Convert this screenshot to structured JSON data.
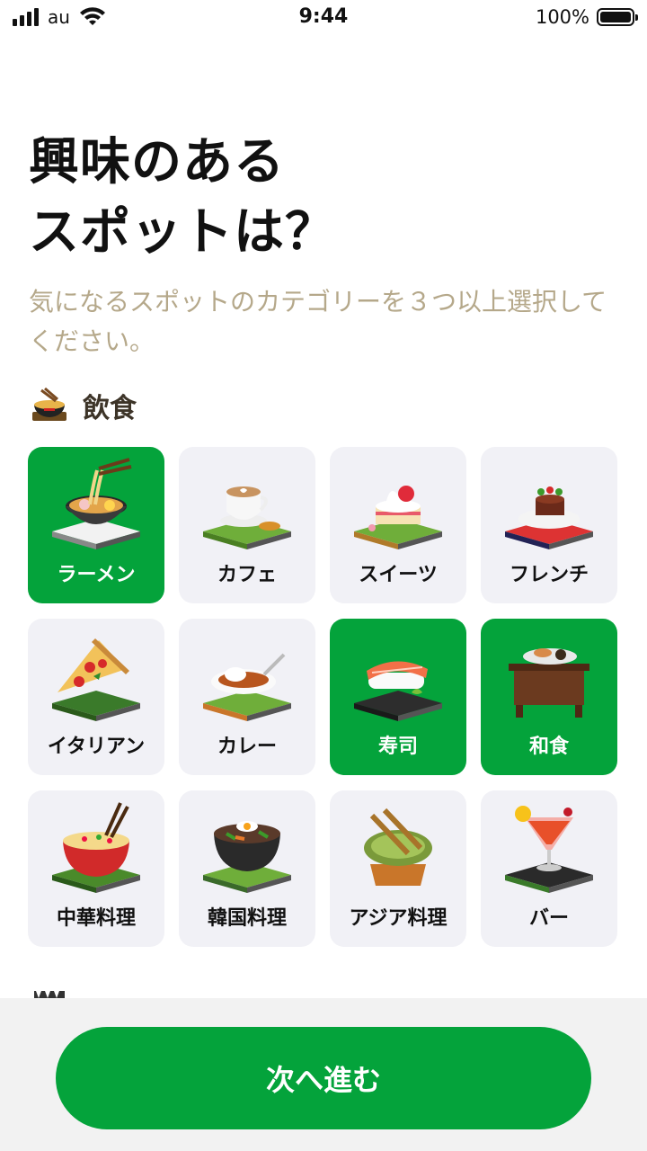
{
  "status_bar": {
    "carrier": "au",
    "time": "9:44",
    "battery_percent": "100%",
    "battery_level": 1.0,
    "icons": [
      "signal-icon",
      "wifi-icon",
      "battery-icon"
    ]
  },
  "title_lines": [
    "興味のある",
    "スポットは？"
  ],
  "subtitle": "気になるスポットのカテゴリーを３つ以上選択してください。",
  "section": {
    "icon": "ramen-bowl-icon",
    "title": "飲食"
  },
  "categories": [
    {
      "label": "ラーメン",
      "icon": "ramen-icon",
      "selected": true
    },
    {
      "label": "カフェ",
      "icon": "cafe-icon",
      "selected": false
    },
    {
      "label": "スイーツ",
      "icon": "sweets-icon",
      "selected": false
    },
    {
      "label": "フレンチ",
      "icon": "french-icon",
      "selected": false
    },
    {
      "label": "イタリアン",
      "icon": "pizza-icon",
      "selected": false
    },
    {
      "label": "カレー",
      "icon": "curry-icon",
      "selected": false
    },
    {
      "label": "寿司",
      "icon": "sushi-icon",
      "selected": true
    },
    {
      "label": "和食",
      "icon": "japanese-food-icon",
      "selected": true
    },
    {
      "label": "中華料理",
      "icon": "fried-rice-icon",
      "selected": false
    },
    {
      "label": "韓国料理",
      "icon": "bibimbap-icon",
      "selected": false
    },
    {
      "label": "アジア料理",
      "icon": "satay-icon",
      "selected": false
    },
    {
      "label": "バー",
      "icon": "cocktail-icon",
      "selected": false
    }
  ],
  "next_section_icon": "clapperboard-icon",
  "footer": {
    "next_label": "次へ進む"
  },
  "colors": {
    "accent": "#04a33b",
    "tile_bg": "#f1f1f6",
    "subtitle": "#b5a88a"
  }
}
